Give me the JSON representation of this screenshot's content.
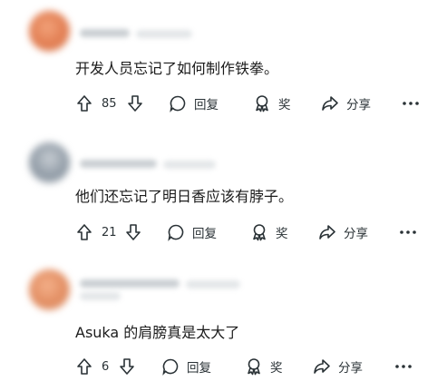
{
  "colors": {
    "text": "#1c1c1c",
    "icon": "#2a3236",
    "background": "#ffffff"
  },
  "comments": [
    {
      "avatar_color": "#e07a4e",
      "text": "开发人员忘记了如何制作铁拳。",
      "votes": "85",
      "actions": {
        "reply": "回复",
        "award": "奖",
        "share": "分享"
      }
    },
    {
      "avatar_color": "#9aa4ae",
      "text": "他们还忘记了明日香应该有脖子。",
      "votes": "21",
      "actions": {
        "reply": "回复",
        "award": "奖",
        "share": "分享"
      }
    },
    {
      "avatar_color": "#e08a5e",
      "text": "Asuka 的肩膀真是太大了",
      "votes": "6",
      "actions": {
        "reply": "回复",
        "award": "奖",
        "share": "分享"
      }
    }
  ]
}
